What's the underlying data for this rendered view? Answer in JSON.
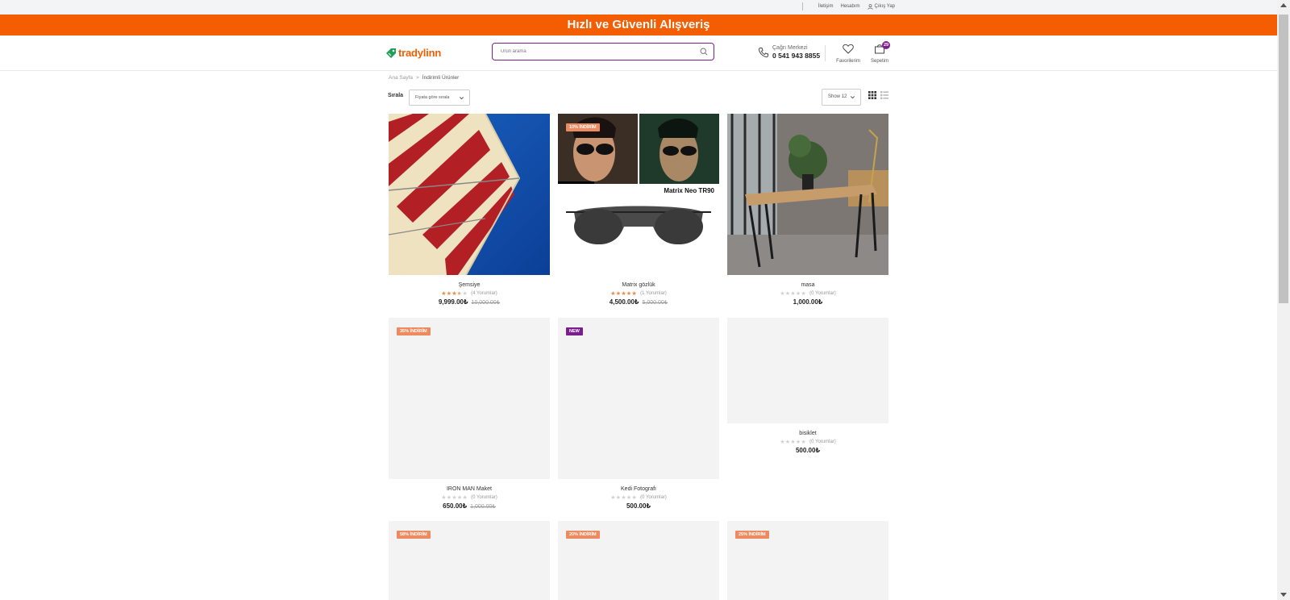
{
  "topbar": {
    "links": [
      "İletişim",
      "Hesabım"
    ],
    "logout_label": "Çıkış Yap"
  },
  "banner": {
    "text": "Hızlı ve Güvenli Alışveriş"
  },
  "header": {
    "logo_text": "tradylinn",
    "search_placeholder": "Ürün arama",
    "call_center_label": "Çağrı Merkezi",
    "call_center_phone": "0 541 943 8855",
    "favorites_label": "Favorilerim",
    "cart_label": "Sepetim",
    "cart_count": "29"
  },
  "breadcrumb": {
    "home": "Ana Sayfa",
    "separator": ">",
    "current": "İndirimli Ürünler"
  },
  "toolbar": {
    "sort_label": "Sırala",
    "sort_value": "Fiyata göre sırala",
    "show_value": "Show 12"
  },
  "products": [
    {
      "name": "Şemsiye",
      "rating": 3.5,
      "reviews": "(4 Yorumlar)",
      "price": "9,999.00₺",
      "old_price": "10,000.00₺",
      "tag": ""
    },
    {
      "name": "Matrix gözlük",
      "rating": 5,
      "reviews": "(1 Yorumlar)",
      "price": "4,500.00₺",
      "old_price": "5,000.00₺",
      "tag": "10% İNDİRİM",
      "image_caption": "Matrix Neo TR90"
    },
    {
      "name": "masa",
      "rating": 0,
      "reviews": "(0 Yorumlar)",
      "price": "1,000.00₺",
      "old_price": "",
      "tag": ""
    },
    {
      "name": "IRON MAN Maket",
      "rating": 0,
      "reviews": "(0 Yorumlar)",
      "price": "650.00₺",
      "old_price": "1,000.00₺",
      "tag": "35% İNDİRİM"
    },
    {
      "name": "Kedi Fotografı",
      "rating": 0,
      "reviews": "(0 Yorumlar)",
      "price": "500.00₺",
      "old_price": "",
      "tag": "NEW"
    },
    {
      "name": "bisiklet",
      "rating": 0,
      "reviews": "(0 Yorumlar)",
      "price": "500.00₺",
      "old_price": "",
      "tag": ""
    },
    {
      "tag": "58% İNDİRİM"
    },
    {
      "tag": "20% İNDİRİM"
    },
    {
      "tag": "25% İNDİRİM"
    }
  ],
  "colors": {
    "brand_orange": "#f45d01",
    "brand_purple": "#7a1f8b",
    "star": "#f28b46"
  }
}
